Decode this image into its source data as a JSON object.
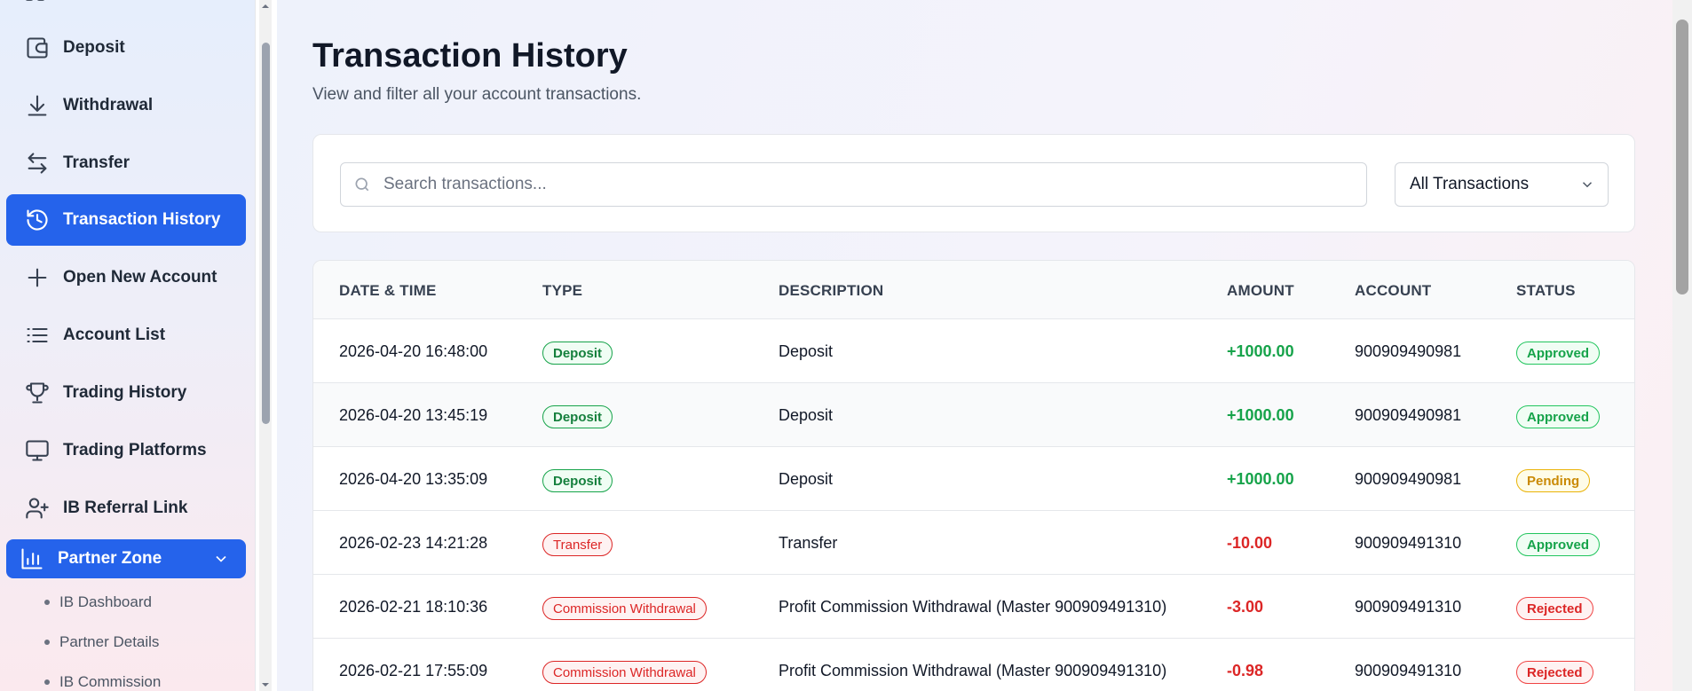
{
  "sidebar": {
    "items": [
      {
        "label": "Deposit",
        "icon": "wallet-icon"
      },
      {
        "label": "Withdrawal",
        "icon": "download-icon"
      },
      {
        "label": "Transfer",
        "icon": "transfer-icon"
      },
      {
        "label": "Transaction History",
        "icon": "history-icon",
        "active": true
      },
      {
        "label": "Open New Account",
        "icon": "plus-icon"
      },
      {
        "label": "Account List",
        "icon": "list-icon"
      },
      {
        "label": "Trading History",
        "icon": "trophy-icon"
      },
      {
        "label": "Trading Platforms",
        "icon": "monitor-icon"
      },
      {
        "label": "IB Referral Link",
        "icon": "user-plus-icon"
      }
    ],
    "group": {
      "label": "Partner Zone",
      "icon": "bar-chart-icon",
      "expanded": true
    },
    "sub_items": [
      {
        "label": "IB Dashboard"
      },
      {
        "label": "Partner Details"
      },
      {
        "label": "IB Commission"
      }
    ]
  },
  "main": {
    "title": "Transaction History",
    "subtitle": "View and filter all your account transactions.",
    "search": {
      "placeholder": "Search transactions...",
      "value": ""
    },
    "filter": {
      "selected": "All Transactions"
    },
    "table": {
      "headers": [
        "DATE & TIME",
        "TYPE",
        "DESCRIPTION",
        "AMOUNT",
        "ACCOUNT",
        "STATUS"
      ],
      "rows": [
        {
          "datetime": "2026-04-20 16:48:00",
          "type": "Deposit",
          "description": "Deposit",
          "amount": "+1000.00",
          "account": "900909490981",
          "status": "Approved"
        },
        {
          "datetime": "2026-04-20 13:45:19",
          "type": "Deposit",
          "description": "Deposit",
          "amount": "+1000.00",
          "account": "900909490981",
          "status": "Approved"
        },
        {
          "datetime": "2026-04-20 13:35:09",
          "type": "Deposit",
          "description": "Deposit",
          "amount": "+1000.00",
          "account": "900909490981",
          "status": "Pending"
        },
        {
          "datetime": "2026-02-23 14:21:28",
          "type": "Transfer",
          "description": "Transfer",
          "amount": "-10.00",
          "account": "900909491310",
          "status": "Approved"
        },
        {
          "datetime": "2026-02-21 18:10:36",
          "type": "Commission Withdrawal",
          "description": "Profit Commission Withdrawal (Master 900909491310)",
          "amount": "-3.00",
          "account": "900909491310",
          "status": "Rejected"
        },
        {
          "datetime": "2026-02-21 17:55:09",
          "type": "Commission Withdrawal",
          "description": "Profit Commission Withdrawal (Master 900909491310)",
          "amount": "-0.98",
          "account": "900909491310",
          "status": "Rejected"
        }
      ]
    }
  },
  "colors": {
    "accent": "#2563eb",
    "positive": "#16a34a",
    "negative": "#dc2626",
    "pending": "#ca8a04"
  }
}
